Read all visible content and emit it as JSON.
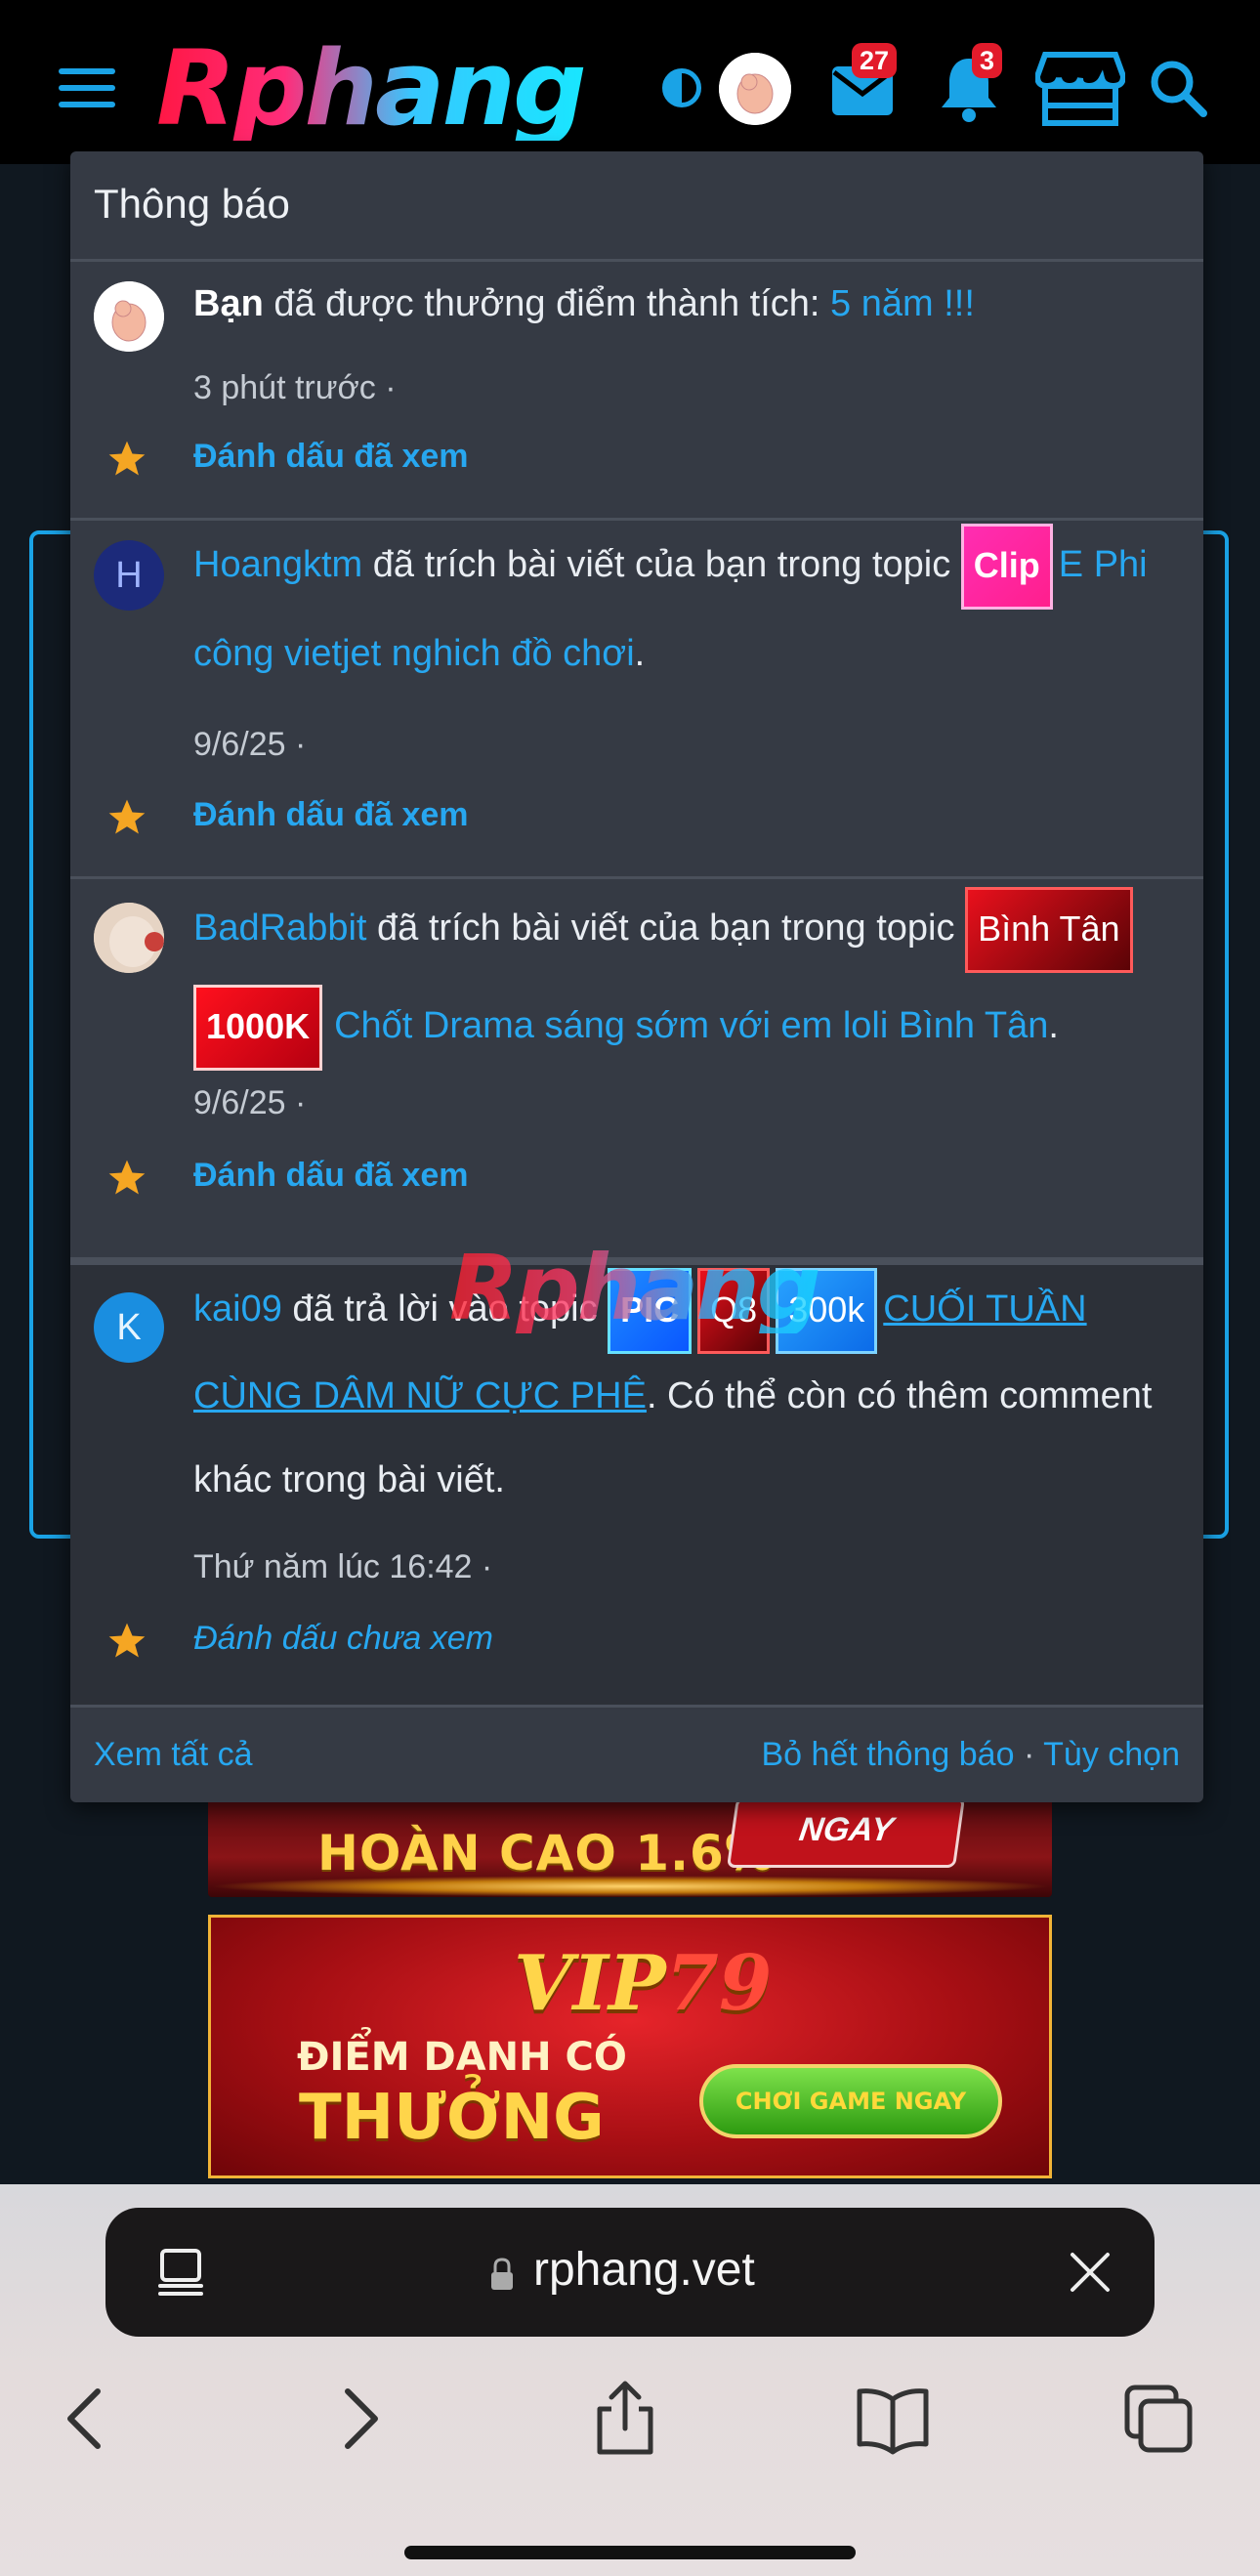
{
  "header": {
    "logo_text": "Rphang",
    "mail_badge": "27",
    "bell_badge": "3"
  },
  "notifications": {
    "title": "Thông báo",
    "items": [
      {
        "actor": "Bạn",
        "text": " đã được thưởng điểm thành tích: ",
        "link": "5 năm !!!",
        "time": "3 phút trước ·",
        "mark": "Đánh dấu đã xem"
      },
      {
        "avatar_letter": "H",
        "actor": "Hoangktm",
        "text": " đã trích bài viết của bạn trong topic ",
        "tags": [
          "Clip"
        ],
        "link": "E Phi công vietjet nghich đồ chơi",
        "after": ".",
        "time": "9/6/25 ·",
        "mark": "Đánh dấu đã xem"
      },
      {
        "actor": "BadRabbit",
        "text": " đã trích bài viết của bạn trong topic ",
        "tags": [
          "Bình Tân",
          "1000K"
        ],
        "link": "Chốt Drama sáng sớm với em loli Bình Tân",
        "after": ".",
        "time": "9/6/25 ·",
        "mark": "Đánh dấu đã xem"
      },
      {
        "avatar_letter": "K",
        "actor": "kai09",
        "text": " đã trả lời vào topic ",
        "tags": [
          "PIC",
          "Q8",
          "300k"
        ],
        "link": "CUỐI TUẦN CÙNG DÂM NỮ CỰC PHÊ",
        "after": ". Có thể còn có thêm comment khác trong bài viết.",
        "time": "Thứ năm lúc 16:42 ·",
        "mark": "Đánh dấu chưa xem"
      }
    ],
    "watermark": "Rphang",
    "footer": {
      "view_all": "Xem tất cả",
      "dismiss_all": "Bỏ hết thông báo",
      "separator": "·",
      "options": "Tùy chọn"
    }
  },
  "banners": {
    "banner1_text": "HOÀN CAO 1.6%",
    "banner1_button": "NGAY",
    "banner2_brand_a": "VIP",
    "banner2_brand_b": "79",
    "banner2_line1": "ĐIỂM DANH CÓ",
    "banner2_line2": "THƯỞNG",
    "banner2_cta": "CHƠI GAME NGAY"
  },
  "browser": {
    "url": "rphang.vet"
  },
  "colors": {
    "accent": "#27a7f0",
    "popup_bg": "#353a44",
    "badge_red": "#e21b2b"
  }
}
